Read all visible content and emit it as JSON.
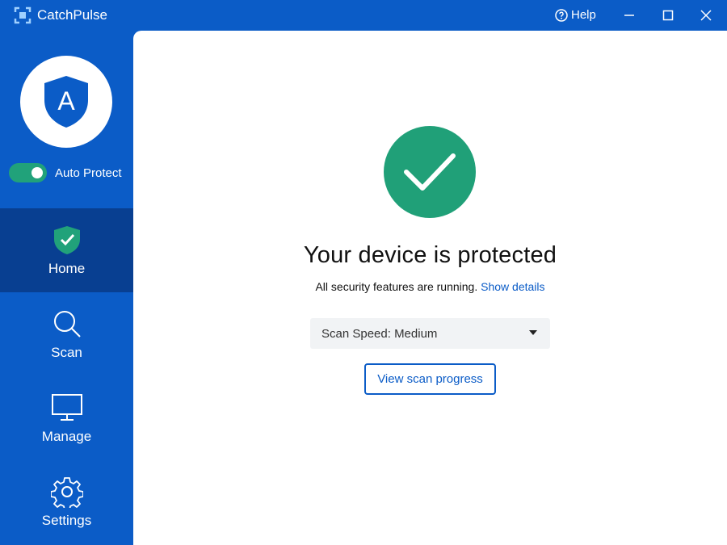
{
  "app": {
    "title": "CatchPulse"
  },
  "titlebar": {
    "help_label": "Help"
  },
  "sidebar": {
    "auto_protect": {
      "label": "Auto Protect",
      "enabled": true
    },
    "items": [
      {
        "label": "Home",
        "icon": "shield-check-icon",
        "active": true
      },
      {
        "label": "Scan",
        "icon": "search-icon",
        "active": false
      },
      {
        "label": "Manage",
        "icon": "monitor-icon",
        "active": false
      },
      {
        "label": "Settings",
        "icon": "gear-icon",
        "active": false
      }
    ]
  },
  "main": {
    "headline": "Your device is protected",
    "subline": "All security features are running.",
    "details_link": "Show details",
    "scan_speed": {
      "value": "Scan Speed: Medium"
    },
    "progress_button": "View scan progress"
  },
  "colors": {
    "brand": "#0b5cc7",
    "active_nav": "#083f91",
    "success": "#20a078",
    "toggle_on": "#21a27a"
  }
}
